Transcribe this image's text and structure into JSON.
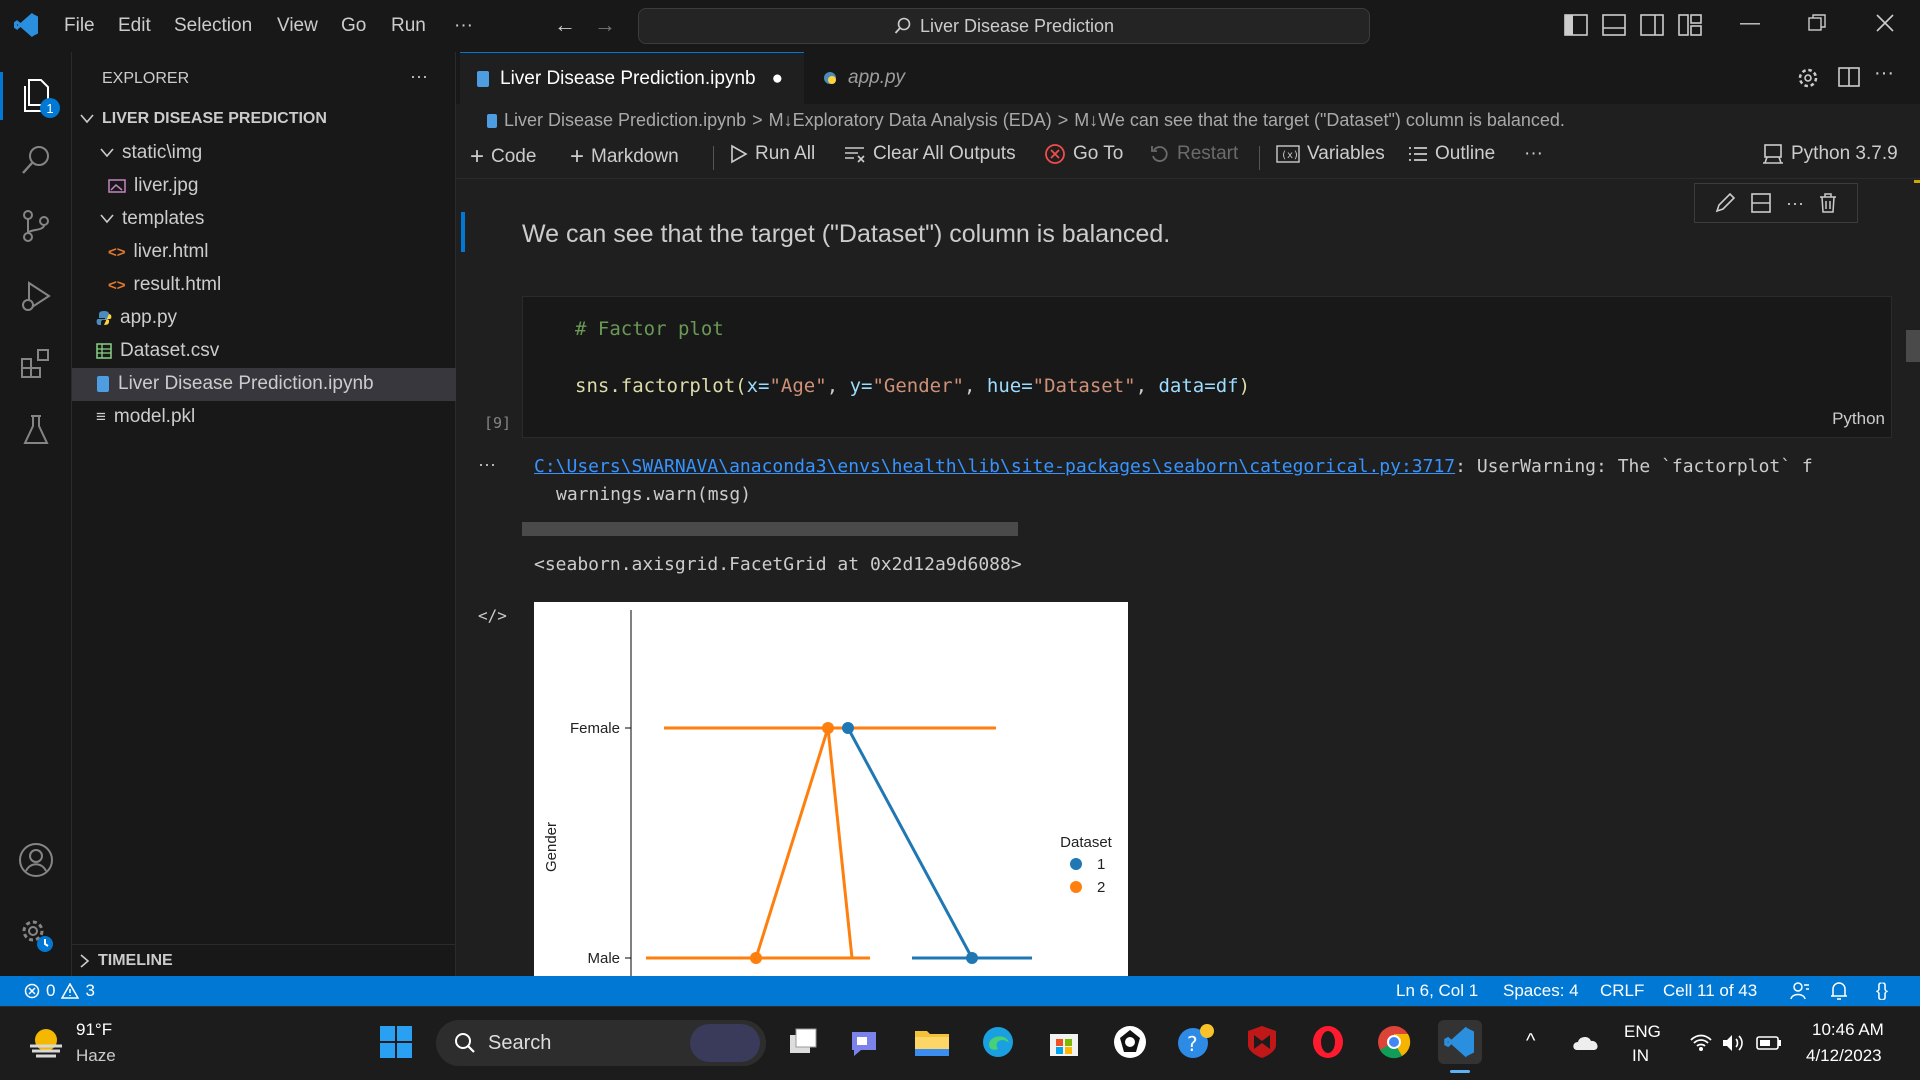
{
  "menu": [
    "File",
    "Edit",
    "Selection",
    "View",
    "Go",
    "Run",
    "···"
  ],
  "search": {
    "label": "Liver Disease Prediction"
  },
  "explorer": {
    "header": "EXPLORER",
    "more": "···",
    "project": "LIVER DISEASE PREDICTION",
    "items": [
      {
        "label": "static\\img",
        "kind": "folder"
      },
      {
        "label": "liver.jpg",
        "kind": "image"
      },
      {
        "label": "templates",
        "kind": "folder"
      },
      {
        "label": "liver.html",
        "kind": "html"
      },
      {
        "label": "result.html",
        "kind": "html"
      },
      {
        "label": "app.py",
        "kind": "python"
      },
      {
        "label": "Dataset.csv",
        "kind": "csv"
      },
      {
        "label": "Liver Disease Prediction.ipynb",
        "kind": "notebook"
      },
      {
        "label": "model.pkl",
        "kind": "file"
      }
    ],
    "timeline": "TIMELINE"
  },
  "badge": "1",
  "tabs": [
    {
      "label": "Liver Disease Prediction.ipynb",
      "dirty": "●"
    },
    {
      "label": "app.py"
    }
  ],
  "breadcrumb": {
    "file": "Liver Disease Prediction.ipynb",
    "sep": ">",
    "md1": "M↓Exploratory Data Analysis (EDA)",
    "md2": "M↓We can see that the target (\"Dataset\") column is balanced."
  },
  "toolbar": {
    "code": "Code",
    "markdown": "Markdown",
    "run_all": "Run All",
    "clear": "Clear All Outputs",
    "goto": "Go To",
    "restart": "Restart",
    "variables": "Variables",
    "outline": "Outline",
    "more": "···",
    "kernel": "Python 3.7.9"
  },
  "cell": {
    "markdown": "We can see that the target (\"Dataset\") column is balanced.",
    "comment": "# Factor plot",
    "code_fn": "sns.factorplot(",
    "code_args": [
      [
        "x=",
        "\"Age\"",
        ", "
      ],
      [
        "y=",
        "\"Gender\"",
        ", "
      ],
      [
        "hue=",
        "\"Dataset\"",
        ", "
      ],
      [
        "data=",
        "df",
        ")"
      ]
    ],
    "exec": "[9]",
    "lang": "Python",
    "warn_path": "C:\\Users\\SWARNAVA\\anaconda3\\envs\\health\\lib\\site-packages\\seaborn\\categorical.py:3717",
    "warn_text": ": UserWarning: The `factorplot` f",
    "warn2": "warnings.warn(msg)",
    "result": "<seaborn.axisgrid.FacetGrid at 0x2d12a9d6088>",
    "out_more": "···",
    "out_icon": "</>"
  },
  "chart_data": {
    "type": "line",
    "ylabel": "Gender",
    "categories": [
      "Female",
      "Male"
    ],
    "legend": {
      "title": "Dataset",
      "position": "right",
      "entries": [
        "1",
        "2"
      ]
    },
    "colors": {
      "1": "#1f77b4",
      "2": "#ff7f0e"
    },
    "note": "x-axis not visible; values shown as Male/Female positions"
  },
  "status": {
    "errors": "0",
    "warnings": "3",
    "ln": "Ln 6, Col 1",
    "spaces": "Spaces: 4",
    "eol": "CRLF",
    "cell": "Cell 11 of 43"
  },
  "taskbar": {
    "temp": "91°F",
    "weather": "Haze",
    "search": "Search",
    "lang1": "ENG",
    "lang2": "IN",
    "time": "10:46 AM",
    "date": "4/12/2023"
  }
}
